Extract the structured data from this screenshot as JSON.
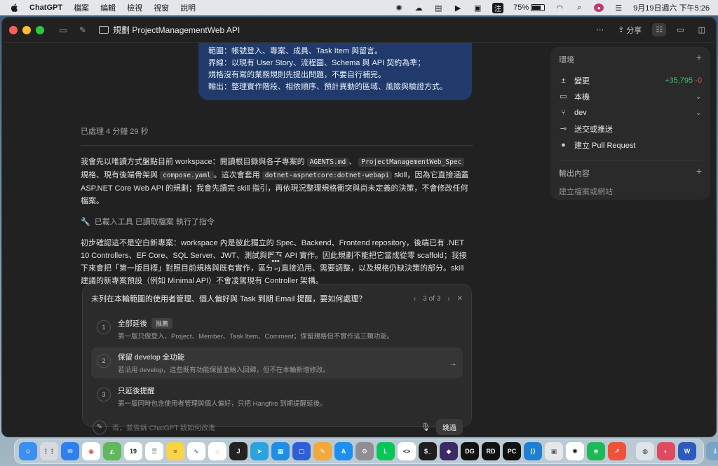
{
  "menubar": {
    "app_name": "ChatGPT",
    "menus": [
      "檔案",
      "編輯",
      "檢視",
      "視窗",
      "說明"
    ],
    "ime_label": "注",
    "battery_text": "75%",
    "battery_level": 0.75,
    "datetime": "9月19日週六 下午5:26"
  },
  "window": {
    "title": "規劃 ProjectManagementWeb API",
    "share_label": "分享"
  },
  "chat": {
    "user_message_lines": [
      "範圍：帳號登入、專案、成員、Task Item 與留言。",
      "界線：以現有 User Story、流程圖、Schema 與 API 契約為準；",
      "規格沒有寫的業務規則先提出問題，不要自行補完。",
      "輸出：整理實作階段、相依順序、預計異動的區域、風險與驗證方式。"
    ],
    "processed_label": "已處理 4 分鐘 29 秒",
    "p1_a": "我會先以唯讀方式盤點目前 workspace：閱讀根目錄與各子專案的",
    "p1_code1": "AGENTS.md",
    "p1_b": "、",
    "p1_code2": "ProjectManagementWeb_Spec",
    "p1_c": "規格、現有後端骨架與",
    "p1_code3": "compose.yaml",
    "p1_d": "。這次會套用",
    "p1_code4": "dotnet-aspnetcore:dotnet-webapi",
    "p1_e": "skill，因為它直接涵蓋 ASP.NET Core Web API 的規劃；我會先讀完 skill 指引，再依現況整理規格衝突與尚未定義的決策，不會修改任何檔案。",
    "tools_line": "已載入工具 已讀取檔案 執行了指令",
    "p2": "初步確認這不是空白新專案：workspace 內是彼此獨立的 Spec、Backend、Frontend repository，後端已有 .NET 10 Controllers、EF Core、SQL Server、JWT、測試與既有 API 實作。因此規劃不能把它當成從零 scaffold；我接下來會把「第一版目標」對照目前規格與既有實作，區分可直接沿用、需要調整，以及規格仍缺決策的部分。skill 建議的新專案預設（例如 Minimal API）不會凌駕現有 Controller 架構。"
  },
  "side": {
    "env_title": "環境",
    "changes_label": "變更",
    "diff_add": "+35,795",
    "diff_del": "-0",
    "local_label": "本機",
    "branch_label": "dev",
    "commit_label": "送交或推送",
    "pr_label": "建立 Pull Request",
    "output_title": "輸出內容",
    "output_hint": "建立檔案或網站"
  },
  "question": {
    "text": "未列在本輪範圍的使用者管理、個人偏好與 Task 到期 Email 提醒，要如何處理？",
    "pager": "3 of 3",
    "options": [
      {
        "num": "1",
        "title": "全部延後",
        "badge": "推薦",
        "desc": "第一版只做登入、Project、Member、Task Item、Comment；保留規格但不實作這三類功能。"
      },
      {
        "num": "2",
        "title": "保留 develop 全功能",
        "desc": "若沿用 develop，這些既有功能保留並納入回歸，但不在本輪新增修改。"
      },
      {
        "num": "3",
        "title": "只延後提醒",
        "desc": "第一版同時包含使用者管理與個人偏好，只把 Hangfire 到期提醒延後。"
      }
    ],
    "input_placeholder": "否，並告訴 ChatGPT 該如何改進",
    "skip_label": "跳過"
  },
  "dock": {
    "calendar_day": "19",
    "apps": [
      "finder",
      "launchpad",
      "mail",
      "chrome",
      "maps",
      "calendar",
      "reminders",
      "notes",
      "freeform",
      "home",
      "jetbrains",
      "telegram",
      "docker",
      "teams-like",
      "notes-orange",
      "app-store",
      "settings",
      "line",
      "vscode-alt",
      "terminal",
      "obsidian",
      "datagrip",
      "rider",
      "pycharm",
      "vscode",
      "preview",
      "chatgpt",
      "spotify",
      "swift",
      "disk",
      "affinity",
      "word",
      "downloads",
      "trash"
    ]
  }
}
